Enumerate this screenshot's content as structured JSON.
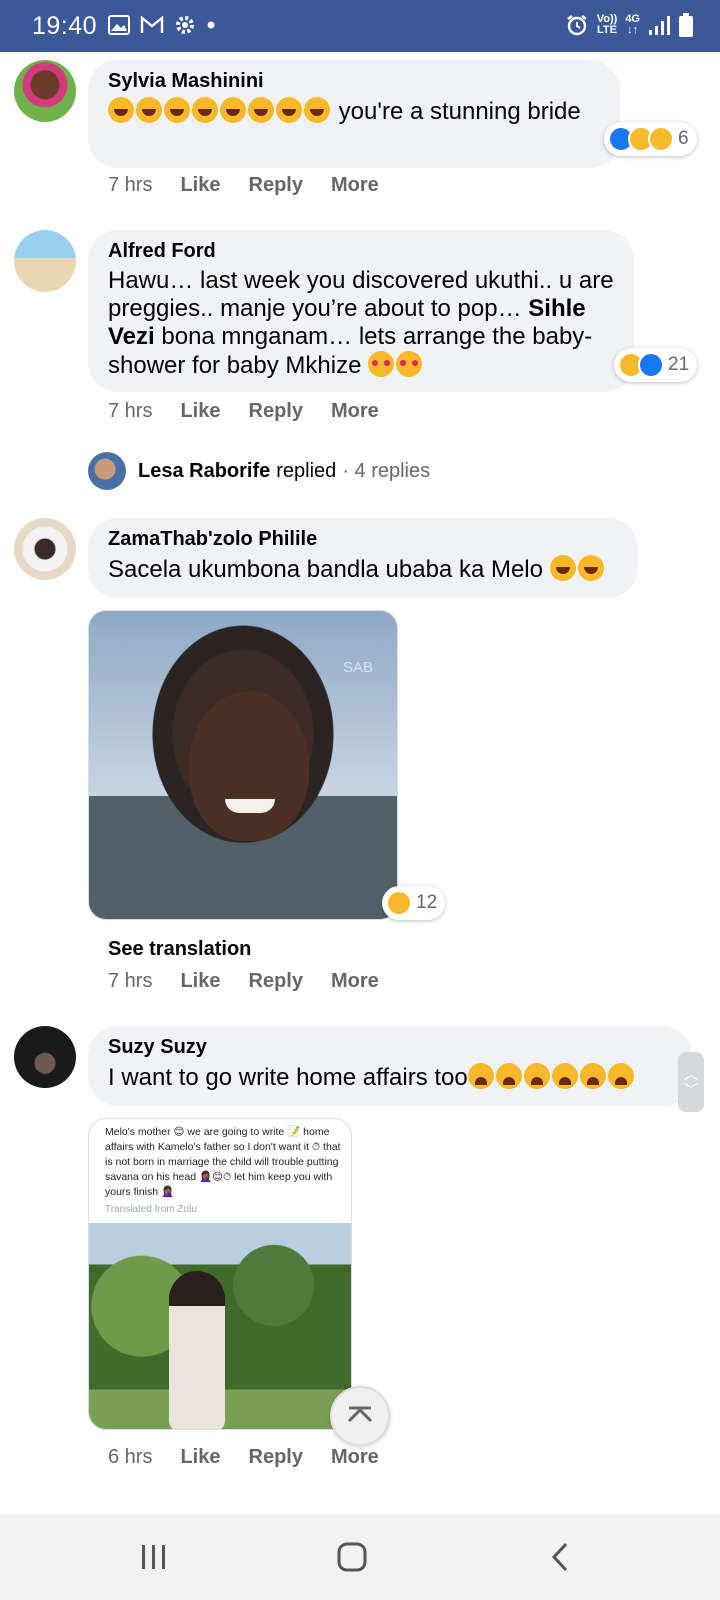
{
  "status_bar": {
    "time": "19:40",
    "network_top": "Vo))",
    "network_bottom": "LTE",
    "gen_top": "4G",
    "gen_bottom": "↓↑",
    "bg_color": "#3b5998",
    "icons": [
      "image-icon",
      "gmail-icon",
      "settings-icon",
      "dot-icon",
      "alarm-icon",
      "signal-icon",
      "battery-icon"
    ]
  },
  "comments": [
    {
      "author": "Sylvia Mashinini",
      "text_after_emoji": "you're a stunning bride",
      "emoji_count": 8,
      "time": "7 hrs",
      "reaction_count": "6",
      "reactions": [
        "like",
        "haha",
        "care"
      ]
    },
    {
      "author": "Alfred Ford",
      "text_1": "Hawu… last week you discovered ukuthi.. u are preggies.. manje you’re about to pop… ",
      "mention": "Sihle Vezi",
      "text_2": " bona mnganam… lets arrange the baby-shower for baby Mkhize ",
      "time": "7 hrs",
      "reaction_count": "21",
      "reactions": [
        "haha",
        "like"
      ]
    },
    {
      "author": "ZamaThab'zolo Philile",
      "text": "Sacela ukumbona bandla ubaba ka Melo ",
      "time": "7 hrs",
      "reaction_count": "12",
      "reactions": [
        "haha"
      ],
      "see_translation": "See translation",
      "photo_watermark": "SAB"
    },
    {
      "author": "Suzy Suzy",
      "text": "I want to go write home affairs too",
      "time": "6 hrs",
      "screenshot_text": "Melo's mother 😊 we are going to write 📝 home affairs with Kamelo's father so I don't want it ⏱ that is not born in marriage the child will trouble putting savana on his head 🤦🏾‍♀️😊⏱ let him keep you with yours finish 🤦🏾‍♀️",
      "screenshot_translated": "Translated from Zulu"
    }
  ],
  "actions": {
    "like": "Like",
    "reply": "Reply",
    "more": "More"
  },
  "reply_summary": {
    "name": "Lesa Raborife",
    "word": "replied",
    "count": "· 4 replies"
  },
  "nav": {
    "icons": [
      "recent-apps-icon",
      "home-icon",
      "back-icon"
    ]
  }
}
